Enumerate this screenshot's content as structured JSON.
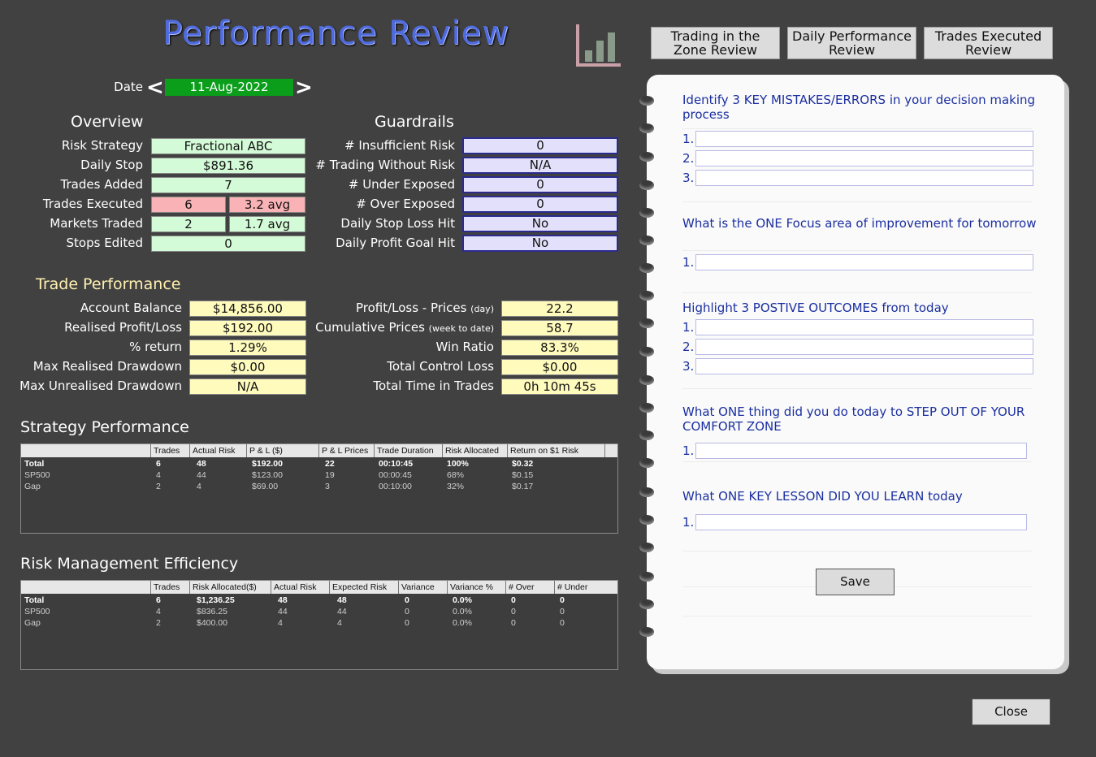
{
  "header": {
    "title": "Performance Review",
    "nav": [
      {
        "l1": "Trading in the",
        "l2": "Zone Review"
      },
      {
        "l1": "Daily Performance",
        "l2": "Review"
      },
      {
        "l1": "Trades Executed",
        "l2": "Review"
      }
    ]
  },
  "date": {
    "label": "Date",
    "value": "11-Aug-2022",
    "prev": "<",
    "next": ">"
  },
  "overview": {
    "heading": "Overview",
    "risk_strategy_label": "Risk Strategy",
    "risk_strategy": "Fractional ABC",
    "daily_stop_label": "Daily Stop",
    "daily_stop": "$891.36",
    "trades_added_label": "Trades Added",
    "trades_added": "7",
    "trades_executed_label": "Trades Executed",
    "trades_executed": "6",
    "trades_executed_avg": "3.2 avg",
    "markets_traded_label": "Markets Traded",
    "markets_traded": "2",
    "markets_traded_avg": "1.7 avg",
    "stops_edited_label": "Stops Edited",
    "stops_edited": "0"
  },
  "guardrails": {
    "heading": "Guardrails",
    "rows": [
      {
        "label": "# Insufficient Risk",
        "value": "0"
      },
      {
        "label": "# Trading Without Risk",
        "value": "N/A"
      },
      {
        "label": "# Under Exposed",
        "value": "0"
      },
      {
        "label": "# Over Exposed",
        "value": "0"
      },
      {
        "label": "Daily Stop Loss Hit",
        "value": "No"
      },
      {
        "label": "Daily Profit Goal Hit",
        "value": "No"
      }
    ]
  },
  "trade_performance": {
    "heading": "Trade Performance",
    "left": [
      {
        "label": "Account Balance",
        "value": "$14,856.00"
      },
      {
        "label": "Realised Profit/Loss",
        "value": "$192.00"
      },
      {
        "label": "% return",
        "value": "1.29%"
      },
      {
        "label": "Max Realised Drawdown",
        "value": "$0.00"
      },
      {
        "label": "Max Unrealised Drawdown",
        "value": "N/A"
      }
    ],
    "right": [
      {
        "label": "Profit/Loss - Prices",
        "sub": "(day)",
        "value": "22.2"
      },
      {
        "label": "Cumulative Prices",
        "sub": "(week to date)",
        "value": "58.7"
      },
      {
        "label": "Win Ratio",
        "sub": "",
        "value": "83.3%"
      },
      {
        "label": "Total Control Loss",
        "sub": "",
        "value": "$0.00"
      },
      {
        "label": "Total Time in Trades",
        "sub": "",
        "value": "0h 10m 45s"
      }
    ]
  },
  "strategy_performance": {
    "heading": "Strategy Performance",
    "columns": [
      "",
      "Trades",
      "Actual Risk",
      "P & L ($)",
      "P & L Prices",
      "Trade Duration",
      "Risk Allocated",
      "Return on $1 Risk"
    ],
    "rows": [
      [
        "Total",
        "6",
        "48",
        "$192.00",
        "22",
        "00:10:45",
        "100%",
        "$0.32"
      ],
      [
        "SP500",
        "4",
        "44",
        "$123.00",
        "19",
        "00:00:45",
        "68%",
        "$0.15"
      ],
      [
        "Gap",
        "2",
        "4",
        "$69.00",
        "3",
        "00:10:00",
        "32%",
        "$0.17"
      ]
    ]
  },
  "risk_management": {
    "heading": "Risk Management Efficiency",
    "columns": [
      "",
      "Trades",
      "Risk Allocated($)",
      "Actual Risk",
      "Expected Risk",
      "Variance",
      "Variance %",
      "# Over",
      "# Under"
    ],
    "rows": [
      [
        "Total",
        "6",
        "$1,236.25",
        "48",
        "48",
        "0",
        "0.0%",
        "0",
        "0"
      ],
      [
        "SP500",
        "4",
        "$836.25",
        "44",
        "44",
        "0",
        "0.0%",
        "0",
        "0"
      ],
      [
        "Gap",
        "2",
        "$400.00",
        "4",
        "4",
        "0",
        "0.0%",
        "0",
        "0"
      ]
    ]
  },
  "notebook": {
    "q1": "Identify 3 KEY MISTAKES/ERRORS in your decision making process",
    "q2": "What is the ONE Focus area of improvement for tomorrow",
    "q3": "Highlight 3 POSTIVE OUTCOMES from today",
    "q4": "What ONE thing did you do today to STEP OUT OF YOUR COMFORT ZONE",
    "q5": "What ONE KEY LESSON DID YOU LEARN today",
    "n1": "1.",
    "n2": "2.",
    "n3": "3.",
    "save": "Save"
  },
  "close": "Close"
}
